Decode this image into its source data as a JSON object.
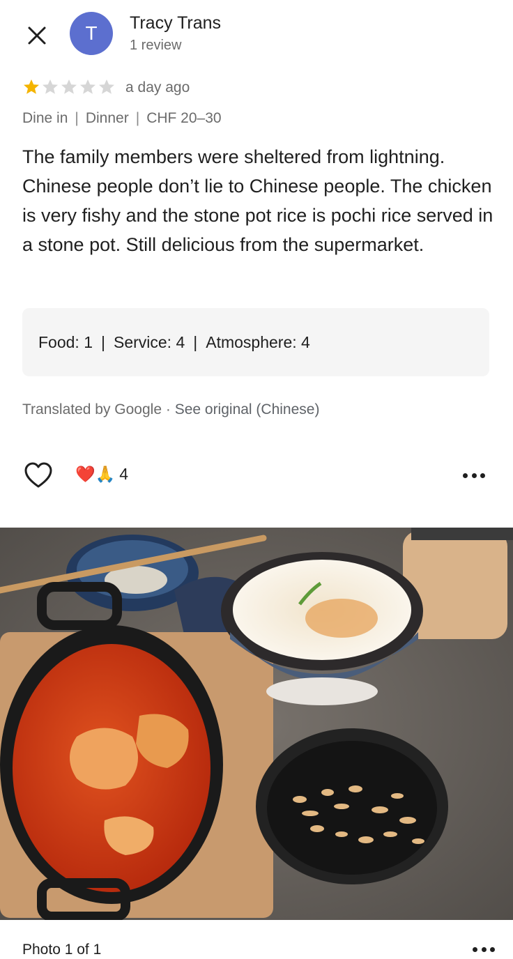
{
  "header": {
    "author_name": "Tracy Trans",
    "avatar_letter": "T",
    "review_count": "1 review"
  },
  "review": {
    "rating": 1,
    "rating_max": 5,
    "time_ago": "a day ago",
    "meta": [
      "Dine in",
      "Dinner",
      "CHF 20–30"
    ],
    "meta_separator": "|",
    "text": "The family members were sheltered from lightning. Chinese people don’t lie to Chinese people. The chicken is very fishy and the stone pot rice is pochi rice served in a stone pot. Still delicious from the supermarket.",
    "ratings": {
      "food": "Food: 1",
      "service": "Service: 4",
      "atmosphere": "Atmosphere: 4",
      "separator": "|"
    },
    "translation": {
      "by": "Translated by Google",
      "dot": " · ",
      "see_original": "See original (Chinese)"
    }
  },
  "actions": {
    "like_icon": "heart-outline-icon",
    "reaction_emojis": "❤️🙏",
    "reaction_count": "4",
    "more_icon": "more-horizontal-icon"
  },
  "photo": {
    "caption": "Photo 1 of 1",
    "more_icon": "more-horizontal-icon"
  },
  "colors": {
    "avatar": "#5c6fcf",
    "star_filled": "#f4b400",
    "star_empty": "#d6d6d6",
    "secondary_text": "#6b6b6b",
    "ratings_box": "#f5f5f5"
  }
}
